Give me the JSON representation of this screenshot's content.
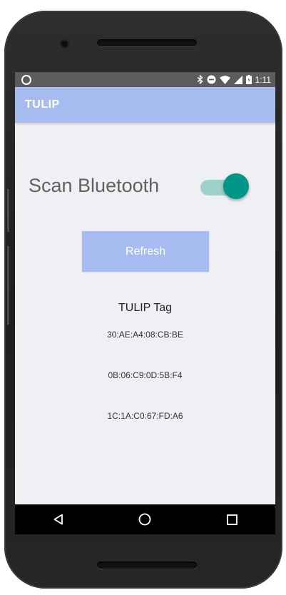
{
  "status_bar": {
    "time": "1:11",
    "icons": [
      "sync-icon",
      "bluetooth-icon",
      "do-not-disturb-icon",
      "wifi-icon",
      "cell-signal-icon",
      "battery-icon"
    ]
  },
  "app_bar": {
    "title": "TULIP",
    "color": "#a6bbef"
  },
  "scan": {
    "label": "Scan Bluetooth",
    "enabled": true,
    "accent": "#009688"
  },
  "refresh_button": {
    "label": "Refresh"
  },
  "tags": {
    "title": "TULIP Tag",
    "items": [
      "30:AE:A4:08:CB:BE",
      "0B:06:C9:0D:5B:F4",
      "1C:1A:C0:67:FD:A6"
    ]
  },
  "nav_bar": {
    "buttons": [
      "back-icon",
      "home-icon",
      "recents-icon"
    ]
  }
}
